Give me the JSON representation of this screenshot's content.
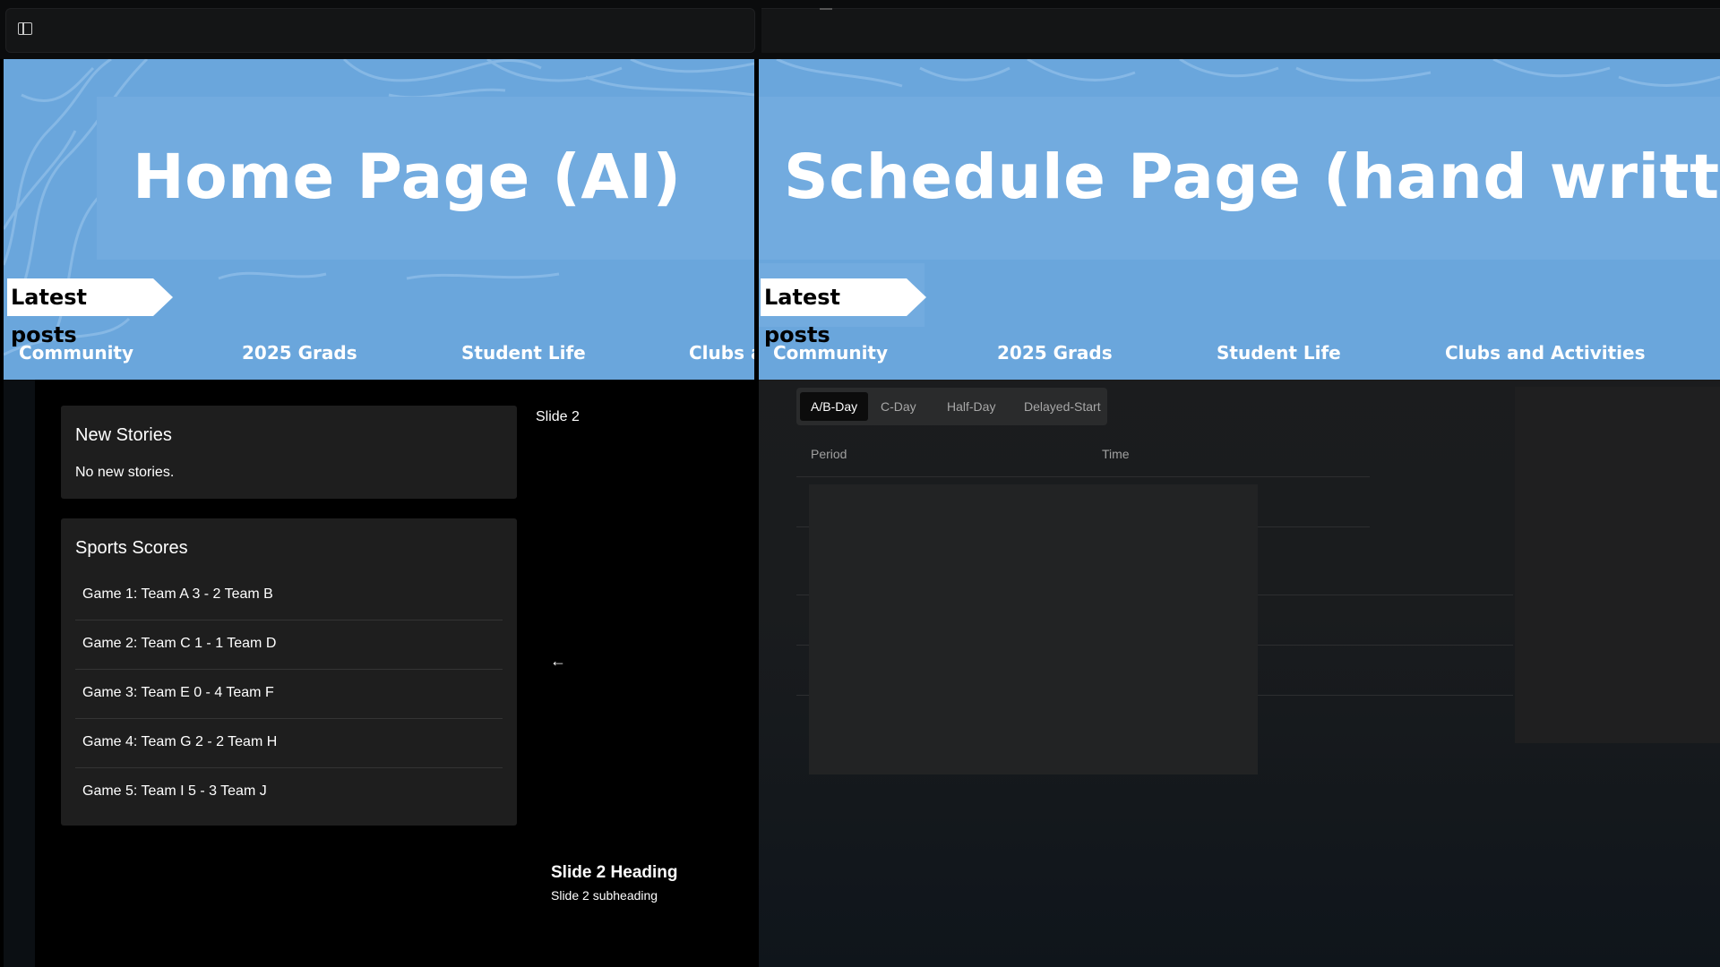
{
  "window": {
    "sidebar_toggle_icon": "sidebar-toggle-icon"
  },
  "left_pane": {
    "banner_title": "Home Page (AI)",
    "latest_posts": "Latest posts",
    "nav": [
      "Community",
      "2025 Grads",
      "Student Life",
      "Clubs a"
    ],
    "new_stories": {
      "heading": "New Stories",
      "empty_text": "No new stories."
    },
    "sports_scores": {
      "heading": "Sports Scores",
      "games": [
        "Game 1: Team A 3 - 2 Team B",
        "Game 2: Team C 1 - 1 Team D",
        "Game 3: Team E 0 - 4 Team F",
        "Game 4: Team G 2 - 2 Team H",
        "Game 5: Team I 5 - 3 Team J"
      ]
    },
    "slideshow": {
      "label": "Slide 2",
      "prev_arrow": "←",
      "heading": "Slide 2 Heading",
      "subheading": "Slide 2 subheading"
    }
  },
  "right_pane": {
    "banner_title": "Schedule Page (hand written)",
    "latest_posts": "Latest posts",
    "nav": [
      "Community",
      "2025 Grads",
      "Student Life",
      "Clubs and Activities"
    ],
    "tabs": [
      "A/B-Day",
      "C-Day",
      "Half-Day",
      "Delayed-Start"
    ],
    "active_tab": "A/B-Day",
    "table_headers": [
      "Period",
      "Time"
    ]
  },
  "colors": {
    "banner_blue": "#6aa6dc",
    "title_box_blue": "#72abdf",
    "card_bg": "#1e1e1e"
  }
}
